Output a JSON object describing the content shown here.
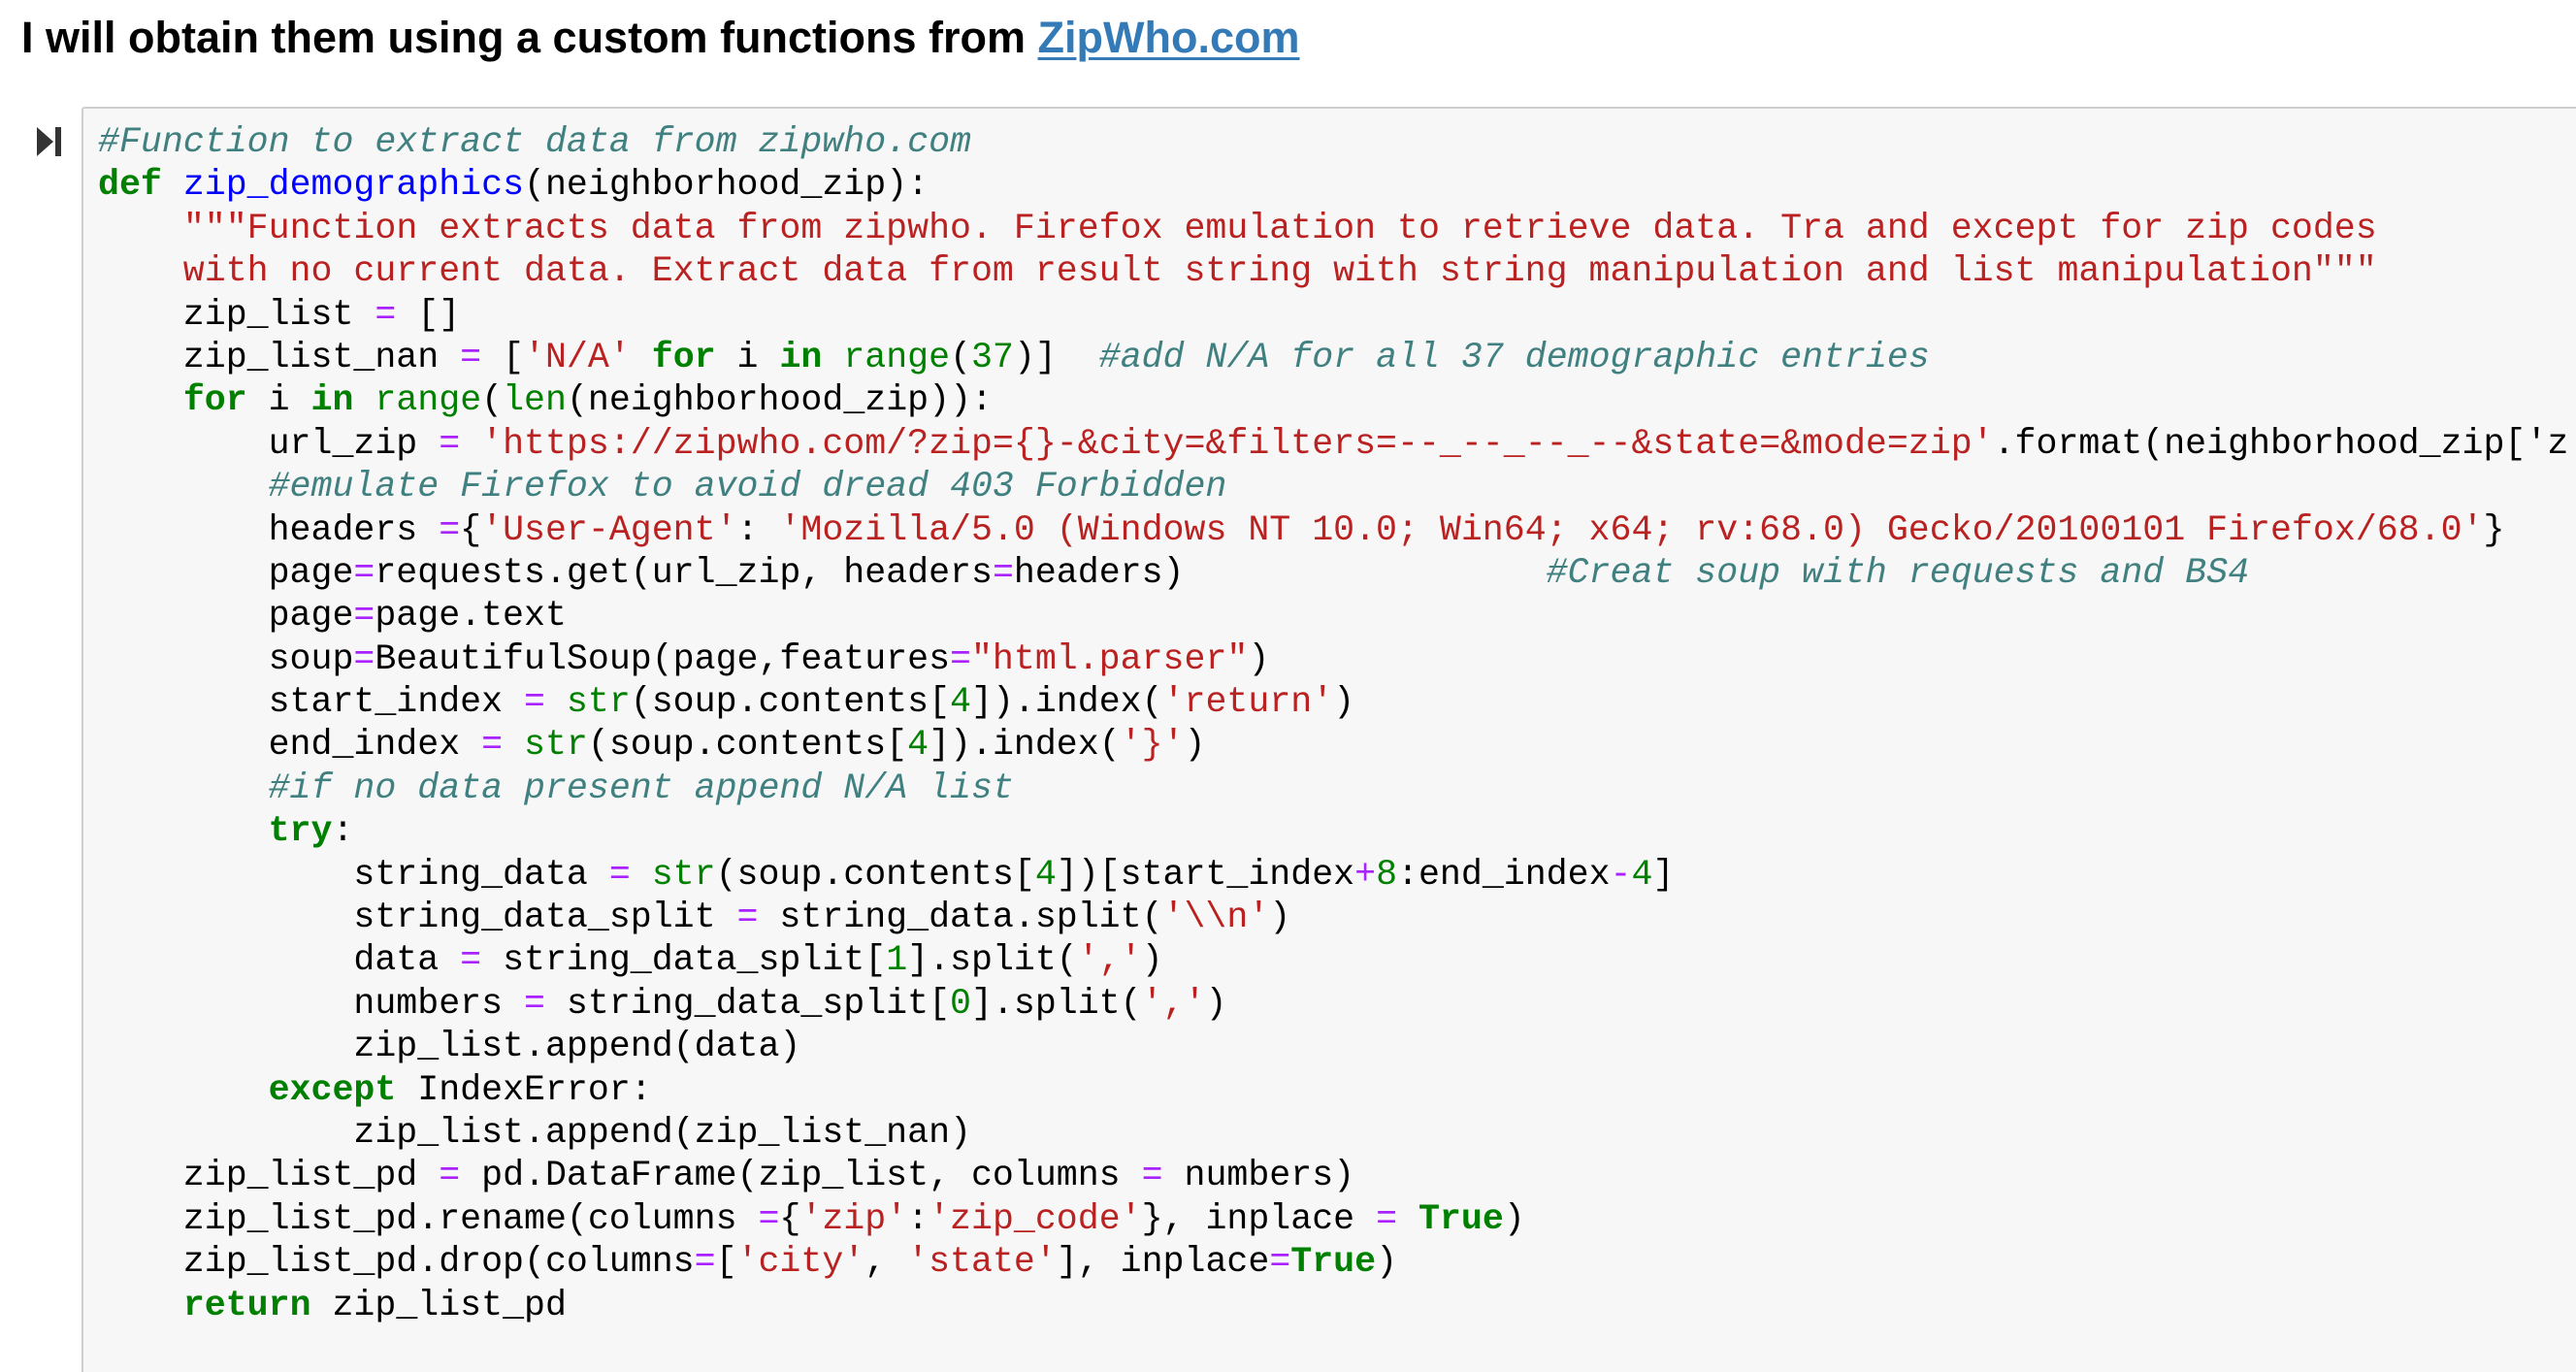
{
  "heading": {
    "text": "I will obtain them using a custom functions from ",
    "link_text": "ZipWho.com"
  },
  "run_button": {
    "icon": "run-cell-icon"
  },
  "code_cell": {
    "lines": [
      [
        [
          "c",
          "#Function to extract data from zipwho.com"
        ]
      ],
      [
        [
          "k",
          "def"
        ],
        [
          "",
          " "
        ],
        [
          "nf",
          "zip_demographics"
        ],
        [
          "",
          "(neighborhood_zip):"
        ]
      ],
      [
        [
          "",
          "    "
        ],
        [
          "s",
          "\"\"\"Function extracts data from zipwho. Firefox emulation to retrieve data. Tra and except for zip codes"
        ]
      ],
      [
        [
          "s",
          "    with no current data. Extract data from result string with string manipulation and list manipulation\"\"\""
        ]
      ],
      [
        [
          "",
          "    zip_list "
        ],
        [
          "o",
          "="
        ],
        [
          "",
          " []"
        ]
      ],
      [
        [
          "",
          "    zip_list_nan "
        ],
        [
          "o",
          "="
        ],
        [
          "",
          " ["
        ],
        [
          "s",
          "'N/A'"
        ],
        [
          "",
          " "
        ],
        [
          "k",
          "for"
        ],
        [
          "",
          " i "
        ],
        [
          "k",
          "in"
        ],
        [
          "",
          " "
        ],
        [
          "nb",
          "range"
        ],
        [
          "",
          "("
        ],
        [
          "m",
          "37"
        ],
        [
          "",
          ")]  "
        ],
        [
          "c",
          "#add N/A for all 37 demographic entries"
        ]
      ],
      [
        [
          "",
          "    "
        ],
        [
          "k",
          "for"
        ],
        [
          "",
          " i "
        ],
        [
          "k",
          "in"
        ],
        [
          "",
          " "
        ],
        [
          "nb",
          "range"
        ],
        [
          "",
          "("
        ],
        [
          "nb",
          "len"
        ],
        [
          "",
          "(neighborhood_zip)):"
        ]
      ],
      [
        [
          "",
          "        url_zip "
        ],
        [
          "o",
          "="
        ],
        [
          "",
          " "
        ],
        [
          "s",
          "'https://zipwho.com/?zip={}-&city=&filters=--_--_--_--&state=&mode=zip'"
        ],
        [
          "",
          ".format(neighborhood_zip['z"
        ]
      ],
      [
        [
          "",
          "        "
        ],
        [
          "c",
          "#emulate Firefox to avoid dread 403 Forbidden"
        ]
      ],
      [
        [
          "",
          "        headers "
        ],
        [
          "o",
          "="
        ],
        [
          "",
          "{"
        ],
        [
          "s",
          "'User-Agent'"
        ],
        [
          "",
          ": "
        ],
        [
          "s",
          "'Mozilla/5.0 (Windows NT 10.0; Win64; x64; rv:68.0) Gecko/20100101 Firefox/68.0'"
        ],
        [
          "",
          "}"
        ]
      ],
      [
        [
          "",
          "        page"
        ],
        [
          "o",
          "="
        ],
        [
          "",
          "requests.get(url_zip, headers"
        ],
        [
          "o",
          "="
        ],
        [
          "",
          "headers)                 "
        ],
        [
          "c",
          "#Creat soup with requests and BS4"
        ]
      ],
      [
        [
          "",
          "        page"
        ],
        [
          "o",
          "="
        ],
        [
          "",
          "page.text"
        ]
      ],
      [
        [
          "",
          "        soup"
        ],
        [
          "o",
          "="
        ],
        [
          "",
          "BeautifulSoup(page,features"
        ],
        [
          "o",
          "="
        ],
        [
          "s",
          "\"html.parser\""
        ],
        [
          "",
          ")"
        ]
      ],
      [
        [
          "",
          "        start_index "
        ],
        [
          "o",
          "="
        ],
        [
          "",
          " "
        ],
        [
          "nb",
          "str"
        ],
        [
          "",
          "(soup.contents["
        ],
        [
          "m",
          "4"
        ],
        [
          "",
          "]).index("
        ],
        [
          "s",
          "'return'"
        ],
        [
          "",
          ")"
        ]
      ],
      [
        [
          "",
          "        end_index "
        ],
        [
          "o",
          "="
        ],
        [
          "",
          " "
        ],
        [
          "nb",
          "str"
        ],
        [
          "",
          "(soup.contents["
        ],
        [
          "m",
          "4"
        ],
        [
          "",
          "]).index("
        ],
        [
          "s",
          "'}'"
        ],
        [
          "",
          ")"
        ]
      ],
      [
        [
          "",
          "        "
        ],
        [
          "c",
          "#if no data present append N/A list"
        ]
      ],
      [
        [
          "",
          "        "
        ],
        [
          "k",
          "try"
        ],
        [
          "",
          ":"
        ]
      ],
      [
        [
          "",
          "            string_data "
        ],
        [
          "o",
          "="
        ],
        [
          "",
          " "
        ],
        [
          "nb",
          "str"
        ],
        [
          "",
          "(soup.contents["
        ],
        [
          "m",
          "4"
        ],
        [
          "",
          "])[start_index"
        ],
        [
          "o",
          "+"
        ],
        [
          "m",
          "8"
        ],
        [
          "",
          ":end_index"
        ],
        [
          "o",
          "-"
        ],
        [
          "m",
          "4"
        ],
        [
          "",
          "]"
        ]
      ],
      [
        [
          "",
          "            string_data_split "
        ],
        [
          "o",
          "="
        ],
        [
          "",
          " string_data.split("
        ],
        [
          "s",
          "'\\\\n'"
        ],
        [
          "",
          ")"
        ]
      ],
      [
        [
          "",
          "            data "
        ],
        [
          "o",
          "="
        ],
        [
          "",
          " string_data_split["
        ],
        [
          "m",
          "1"
        ],
        [
          "",
          "].split("
        ],
        [
          "s",
          "','"
        ],
        [
          "",
          ")"
        ]
      ],
      [
        [
          "",
          "            numbers "
        ],
        [
          "o",
          "="
        ],
        [
          "",
          " string_data_split["
        ],
        [
          "m",
          "0"
        ],
        [
          "",
          "].split("
        ],
        [
          "s",
          "','"
        ],
        [
          "",
          ")"
        ]
      ],
      [
        [
          "",
          "            zip_list.append(data)"
        ]
      ],
      [
        [
          "",
          "        "
        ],
        [
          "k",
          "except"
        ],
        [
          "",
          " IndexError:"
        ]
      ],
      [
        [
          "",
          "            zip_list.append(zip_list_nan)"
        ]
      ],
      [
        [
          "",
          "    zip_list_pd "
        ],
        [
          "o",
          "="
        ],
        [
          "",
          " pd.DataFrame(zip_list, columns "
        ],
        [
          "o",
          "="
        ],
        [
          "",
          " numbers)"
        ]
      ],
      [
        [
          "",
          "    zip_list_pd.rename(columns "
        ],
        [
          "o",
          "="
        ],
        [
          "",
          "{"
        ],
        [
          "s",
          "'zip'"
        ],
        [
          "",
          ":"
        ],
        [
          "s",
          "'zip_code'"
        ],
        [
          "",
          "}, inplace "
        ],
        [
          "o",
          "="
        ],
        [
          "",
          " "
        ],
        [
          "k",
          "True"
        ],
        [
          "",
          ")"
        ]
      ],
      [
        [
          "",
          "    zip_list_pd.drop(columns"
        ],
        [
          "o",
          "="
        ],
        [
          "",
          "["
        ],
        [
          "s",
          "'city'"
        ],
        [
          "",
          ", "
        ],
        [
          "s",
          "'state'"
        ],
        [
          "",
          "], inplace"
        ],
        [
          "o",
          "="
        ],
        [
          "k",
          "True"
        ],
        [
          "",
          ")"
        ]
      ],
      [
        [
          "",
          "    "
        ],
        [
          "k",
          "return"
        ],
        [
          "",
          " zip_list_pd"
        ]
      ]
    ]
  },
  "colors": {
    "comment": "#408080",
    "keyword": "#008000",
    "string": "#ba2121",
    "function_name": "#0000ff",
    "builtin": "#008000",
    "operator": "#aa22ff",
    "number": "#008000",
    "link": "#337ab7",
    "cell_background": "#f7f7f7",
    "cell_border": "#cfcfcf"
  }
}
